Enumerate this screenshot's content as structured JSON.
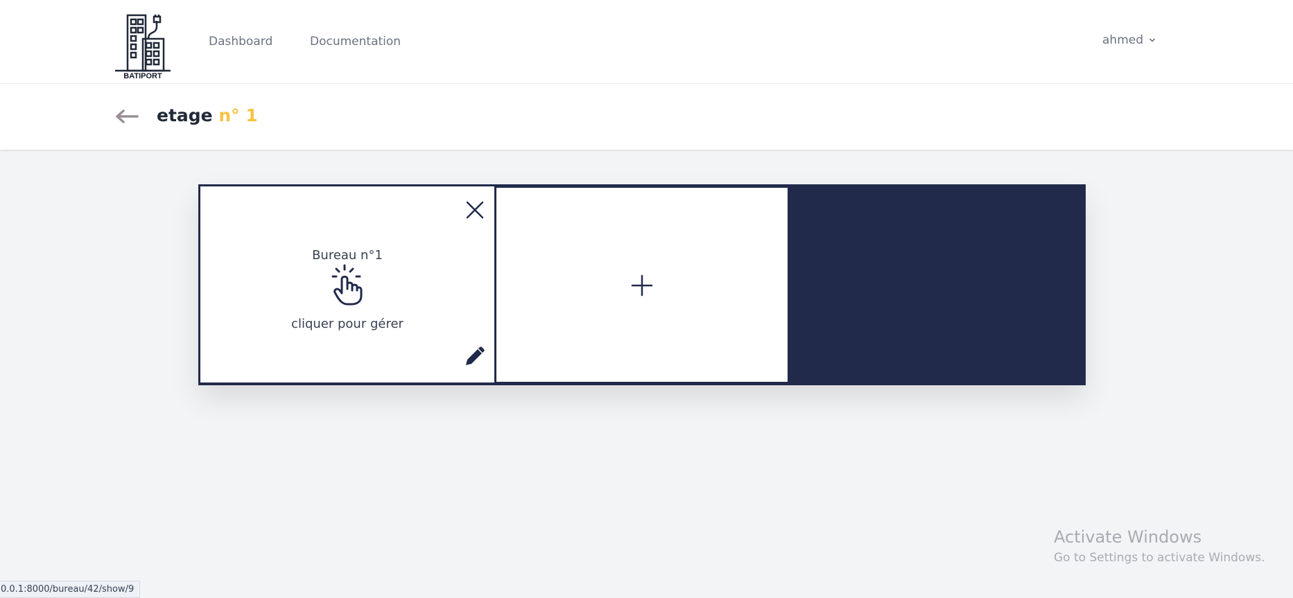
{
  "brand": {
    "logo_text": "BATIPORT"
  },
  "nav": {
    "links": [
      {
        "label": "Dashboard"
      },
      {
        "label": "Documentation"
      }
    ],
    "user": {
      "name": "ahmed",
      "icon": "chevron-down-icon"
    }
  },
  "header": {
    "back_icon": "arrow-left-icon",
    "title_main": "etage",
    "title_accent": "n° 1",
    "accent_color": "#f6c343"
  },
  "floor": {
    "background_color": "#212a4a",
    "offices": [
      {
        "title": "Bureau n°1",
        "hint": "cliquer pour gérer",
        "icons": [
          "close-icon",
          "tap-hand-icon",
          "pencil-icon"
        ]
      }
    ],
    "add_card": {
      "icon": "plus-icon"
    }
  },
  "watermark": {
    "title": "Activate Windows",
    "subtitle": "Go to Settings to activate Windows."
  },
  "status_bar": {
    "url": "0.0.1:8000/bureau/42/show/9"
  }
}
